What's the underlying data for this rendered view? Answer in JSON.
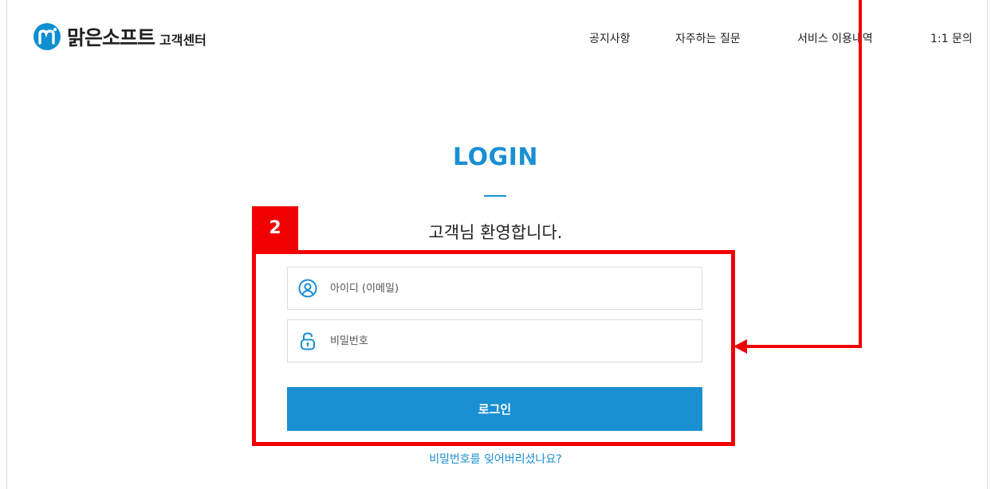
{
  "header": {
    "brand": "맑은소프트",
    "brand_sub": "고객센터",
    "nav": [
      {
        "label": "공지사항"
      },
      {
        "label": "자주하는 질문"
      },
      {
        "label": "서비스 이용내역"
      },
      {
        "label": "1:1 문의"
      }
    ]
  },
  "login": {
    "title": "LOGIN",
    "welcome": "고객님 환영합니다.",
    "id_placeholder": "아이디 (이메일)",
    "pw_placeholder": "비밀번호",
    "button_label": "로그인",
    "forgot_link": "비밀번호를 잊어버리셨나요?"
  },
  "annotation": {
    "badge": "2"
  },
  "colors": {
    "accent": "#1a8fd1",
    "annotation": "#f00000"
  },
  "icons": {
    "logo": "m-logo-icon",
    "id_field": "user-circle-icon",
    "pw_field": "lock-icon"
  }
}
